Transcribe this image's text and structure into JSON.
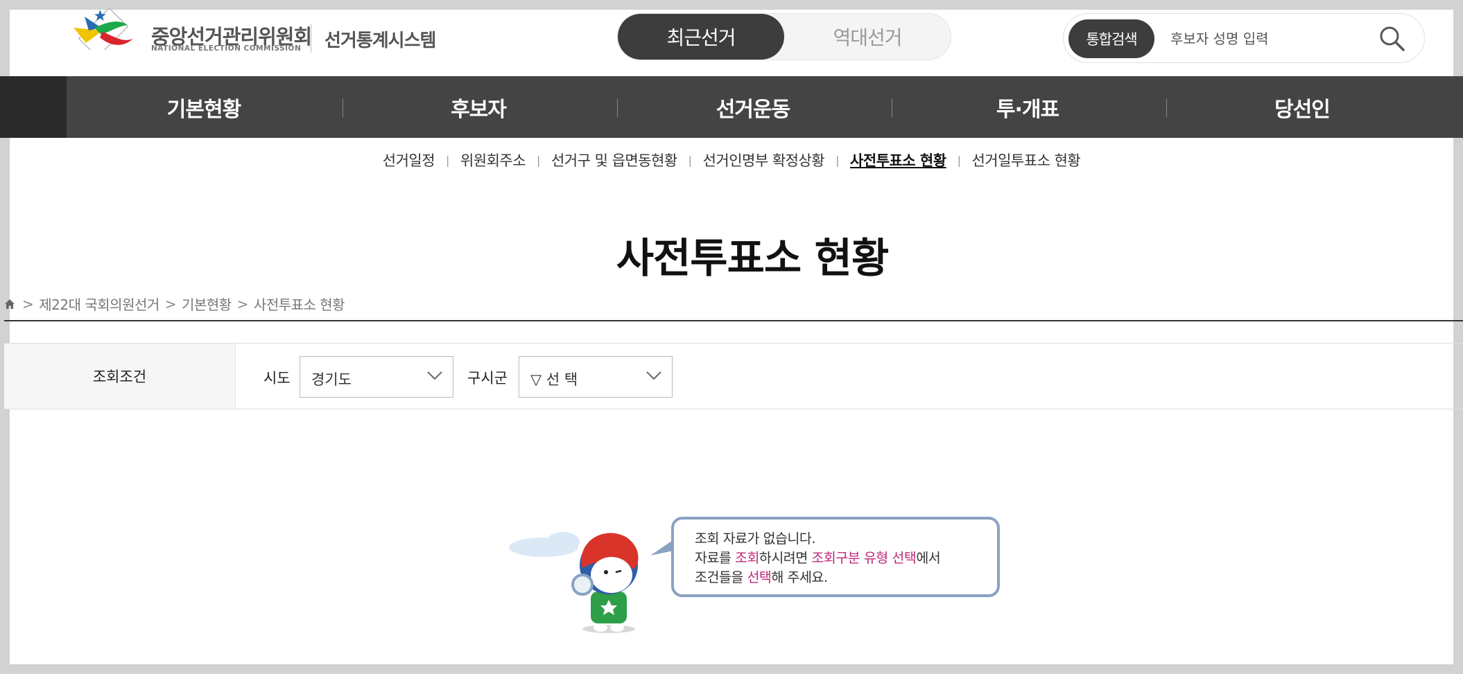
{
  "header": {
    "org_name_ko": "중앙선거관리위원회",
    "org_name_en": "NATIONAL ELECTION COMMISSION",
    "system_name": "선거통계시스템",
    "toggle": {
      "active": "최근선거",
      "inactive": "역대선거"
    },
    "search": {
      "label": "통합검색",
      "placeholder": "후보자 성명 입력"
    }
  },
  "gnb": [
    "기본현황",
    "후보자",
    "선거운동",
    "투·개표",
    "당선인"
  ],
  "submenu": {
    "items": [
      "선거일정",
      "위원회주소",
      "선거구 및 읍면동현황",
      "선거인명부 확정상황",
      "사전투표소 현황",
      "선거일투표소 현황"
    ],
    "active": "사전투표소 현황"
  },
  "page_title": "사전투표소 현황",
  "breadcrumb": [
    ">",
    "제22대 국회의원선거",
    ">",
    "기본현황",
    ">",
    "사전투표소 현황"
  ],
  "conditions": {
    "heading": "조회조건",
    "sido_label": "시도",
    "sido_value": "경기도",
    "sigungu_label": "구시군",
    "sigungu_value": "▽ 선 택"
  },
  "empty_state": {
    "line1": "조회 자료가 없습니다.",
    "line2": [
      "자료를 ",
      "조회",
      "하시려면 ",
      "조회구분 유형 선택",
      "에서"
    ],
    "line3": [
      "조건들을 ",
      "선택",
      "해 주세요."
    ]
  },
  "colors": {
    "nav_bg": "#444444",
    "accent_pink": "#c0297a",
    "bubble_border": "#8aa2c2"
  }
}
